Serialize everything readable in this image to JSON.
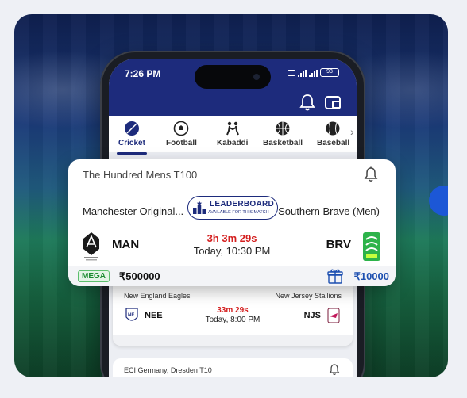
{
  "colors": {
    "brand_navy": "#1d2b7c",
    "countdown_red": "#d41f1f",
    "mega_green": "#198a2f",
    "fee_blue": "#1d4fb0"
  },
  "status_bar": {
    "time": "7:26 PM",
    "battery": "93"
  },
  "header_icons": [
    "bell-icon",
    "wallet-icon"
  ],
  "sports_tabs": [
    {
      "label": "Cricket",
      "icon": "cricket-ball-icon",
      "active": true
    },
    {
      "label": "Football",
      "icon": "football-icon",
      "active": false
    },
    {
      "label": "Kabaddi",
      "icon": "kabaddi-icon",
      "active": false
    },
    {
      "label": "Basketball",
      "icon": "basketball-icon",
      "active": false
    },
    {
      "label": "Baseball",
      "icon": "baseball-icon",
      "active": false
    }
  ],
  "featured_match": {
    "league": "The Hundred Mens  T100",
    "team1_name": "Manchester Original...",
    "team2_name": "Southern Brave (Men)",
    "leaderboard_title": "LEADERBOARD",
    "leaderboard_sub": "AVAILABLE FOR THIS MATCH",
    "team1_code": "MAN",
    "team2_code": "BRV",
    "countdown": "3h 3m 29s",
    "start_time": "Today, 10:30 PM",
    "tag": "MEGA",
    "prize_pool": "₹500000",
    "entry_fee": "₹10000"
  },
  "second_match": {
    "team1_name": "New England Eagles",
    "team2_name": "New Jersey Stallions",
    "team1_code": "NEE",
    "team2_code": "NJS",
    "countdown": "33m 29s",
    "start_time": "Today, 8:00 PM"
  },
  "third_match": {
    "league": "ECI Germany, Dresden  T10"
  }
}
